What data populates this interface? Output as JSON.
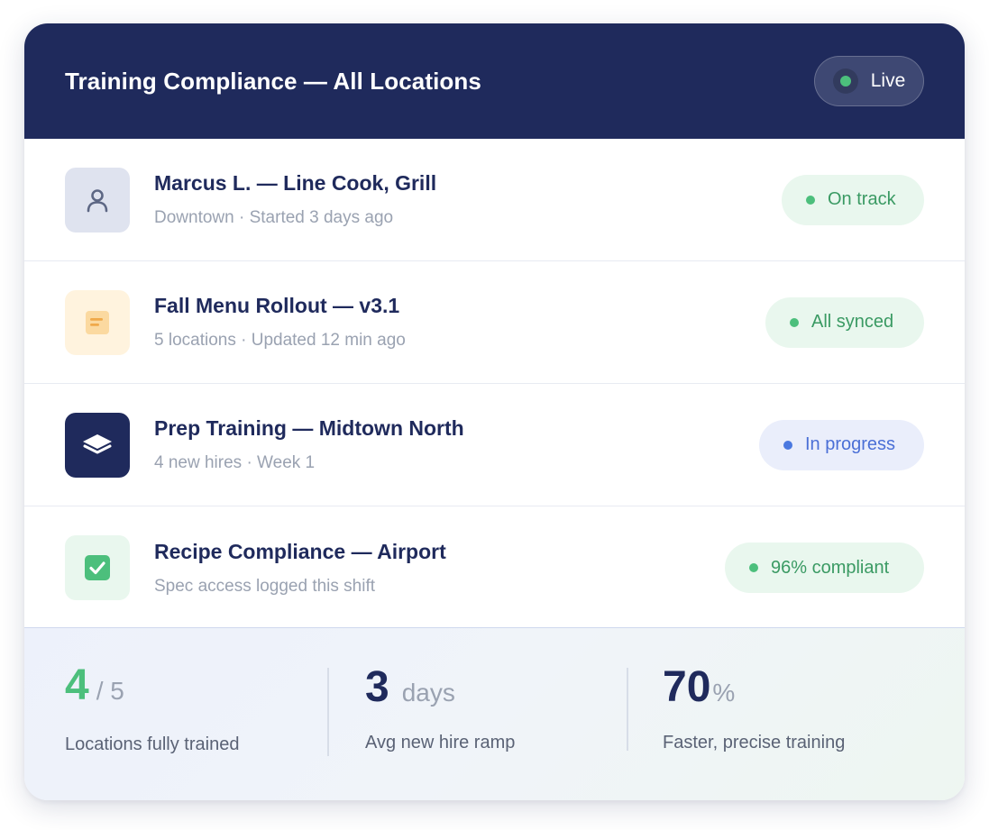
{
  "header": {
    "title": "Training Compliance — All Locations",
    "live_label": "Live"
  },
  "rows": [
    {
      "title": "Marcus L. — Line Cook, Grill",
      "subtitle": "Downtown · Started 3 days ago",
      "icon": "user-icon",
      "badge": "On track",
      "badge_color": "#4cbf7c"
    },
    {
      "title": "Fall Menu Rollout — v3.1",
      "subtitle": "5 locations · Updated 12 min ago",
      "icon": "document-icon",
      "badge": "All synced",
      "badge_color": "#4cbf7c"
    },
    {
      "title": "Prep Training — Midtown North",
      "subtitle": "4 new hires · Week 1",
      "icon": "layers-icon",
      "badge": "In progress",
      "badge_color": "#4a78e0"
    },
    {
      "title": "Recipe Compliance — Airport",
      "subtitle": "Spec access logged this shift",
      "icon": "checkbox-icon",
      "badge": "96% compliant",
      "badge_color": "#4cbf7c"
    }
  ],
  "stats": [
    {
      "value": "4",
      "suffix": "/ 5",
      "label": "Locations fully trained"
    },
    {
      "value": "3",
      "suffix": "days",
      "label": "Avg new hire ramp"
    },
    {
      "value": "70",
      "suffix": "%",
      "label": "Faster, precise training"
    }
  ],
  "colors": {
    "header_bg": "#1f2a5c",
    "accent_green": "#4cbf7c",
    "accent_blue": "#4a78e0"
  }
}
